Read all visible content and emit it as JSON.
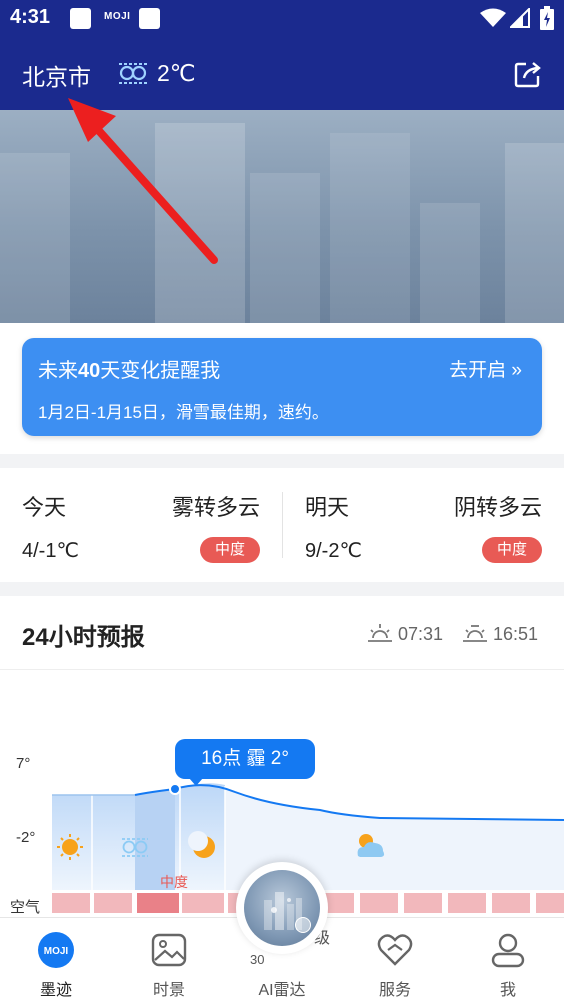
{
  "status_bar": {
    "time": "4:31",
    "moji_label": "MOJI"
  },
  "header": {
    "city": "北京市",
    "weather_icon": "fog-icon",
    "temperature": "2℃",
    "share_icon": "share-icon"
  },
  "reminder": {
    "title_prefix": "未来",
    "title_bold": "40",
    "title_suffix": "天变化提醒我",
    "action": "去开启",
    "subtitle": "1月2日-1月15日，滑雪最佳期，速约。"
  },
  "today": {
    "label": "今天",
    "weather": "雾转多云",
    "temp": "4/-1℃",
    "aqi": "中度"
  },
  "tomorrow": {
    "label": "明天",
    "weather": "阴转多云",
    "temp": "9/-2℃",
    "aqi": "中度"
  },
  "forecast": {
    "title": "24小时预报",
    "sunrise": "07:31",
    "sunset": "16:51",
    "y_max": "7°",
    "y_min": "-2°",
    "tooltip": "16点 霾 2°",
    "aqi_row_label": "空气",
    "aqi_highlight": "中度",
    "ghost_level": "级",
    "ghost_num": "30",
    "hourly_icons": [
      "sun-icon",
      "fog-icon",
      "moon-icon",
      "partly-cloudy-icon"
    ]
  },
  "colors": {
    "header_bg": "#1b2a8e",
    "reminder_bg": "#3d8ff2",
    "aqi_badge": "#e85a55",
    "accent_blue": "#1479f2"
  },
  "bottom_nav": {
    "items": [
      {
        "label": "墨迹",
        "icon": "moji-icon"
      },
      {
        "label": "时景",
        "icon": "photo-icon"
      },
      {
        "label": "AI雷达",
        "icon": "radar-icon"
      },
      {
        "label": "服务",
        "icon": "service-icon"
      },
      {
        "label": "我",
        "icon": "profile-icon"
      }
    ]
  }
}
